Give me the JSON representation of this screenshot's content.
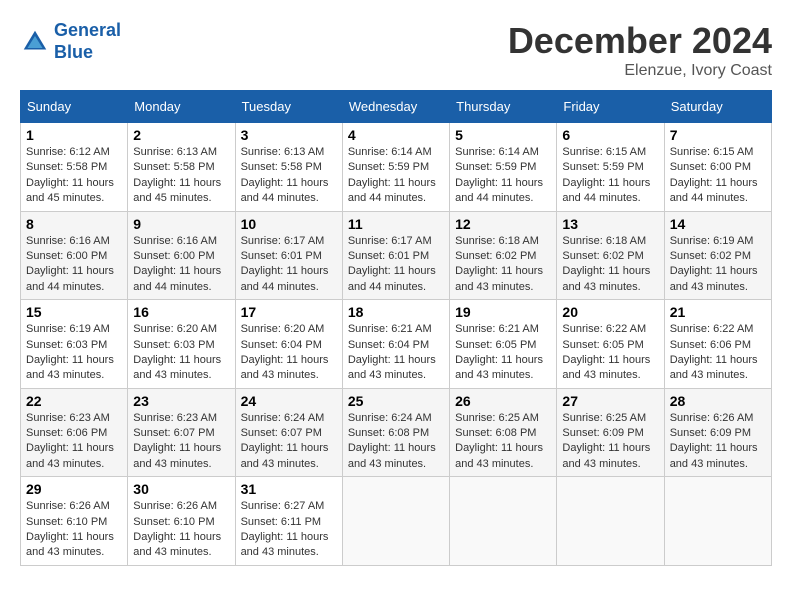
{
  "header": {
    "logo_line1": "General",
    "logo_line2": "Blue",
    "month_title": "December 2024",
    "location": "Elenzue, Ivory Coast"
  },
  "days_of_week": [
    "Sunday",
    "Monday",
    "Tuesday",
    "Wednesday",
    "Thursday",
    "Friday",
    "Saturday"
  ],
  "weeks": [
    [
      {
        "day": "1",
        "sunrise": "6:12 AM",
        "sunset": "5:58 PM",
        "daylight": "11 hours and 45 minutes."
      },
      {
        "day": "2",
        "sunrise": "6:13 AM",
        "sunset": "5:58 PM",
        "daylight": "11 hours and 45 minutes."
      },
      {
        "day": "3",
        "sunrise": "6:13 AM",
        "sunset": "5:58 PM",
        "daylight": "11 hours and 44 minutes."
      },
      {
        "day": "4",
        "sunrise": "6:14 AM",
        "sunset": "5:59 PM",
        "daylight": "11 hours and 44 minutes."
      },
      {
        "day": "5",
        "sunrise": "6:14 AM",
        "sunset": "5:59 PM",
        "daylight": "11 hours and 44 minutes."
      },
      {
        "day": "6",
        "sunrise": "6:15 AM",
        "sunset": "5:59 PM",
        "daylight": "11 hours and 44 minutes."
      },
      {
        "day": "7",
        "sunrise": "6:15 AM",
        "sunset": "6:00 PM",
        "daylight": "11 hours and 44 minutes."
      }
    ],
    [
      {
        "day": "8",
        "sunrise": "6:16 AM",
        "sunset": "6:00 PM",
        "daylight": "11 hours and 44 minutes."
      },
      {
        "day": "9",
        "sunrise": "6:16 AM",
        "sunset": "6:00 PM",
        "daylight": "11 hours and 44 minutes."
      },
      {
        "day": "10",
        "sunrise": "6:17 AM",
        "sunset": "6:01 PM",
        "daylight": "11 hours and 44 minutes."
      },
      {
        "day": "11",
        "sunrise": "6:17 AM",
        "sunset": "6:01 PM",
        "daylight": "11 hours and 44 minutes."
      },
      {
        "day": "12",
        "sunrise": "6:18 AM",
        "sunset": "6:02 PM",
        "daylight": "11 hours and 43 minutes."
      },
      {
        "day": "13",
        "sunrise": "6:18 AM",
        "sunset": "6:02 PM",
        "daylight": "11 hours and 43 minutes."
      },
      {
        "day": "14",
        "sunrise": "6:19 AM",
        "sunset": "6:02 PM",
        "daylight": "11 hours and 43 minutes."
      }
    ],
    [
      {
        "day": "15",
        "sunrise": "6:19 AM",
        "sunset": "6:03 PM",
        "daylight": "11 hours and 43 minutes."
      },
      {
        "day": "16",
        "sunrise": "6:20 AM",
        "sunset": "6:03 PM",
        "daylight": "11 hours and 43 minutes."
      },
      {
        "day": "17",
        "sunrise": "6:20 AM",
        "sunset": "6:04 PM",
        "daylight": "11 hours and 43 minutes."
      },
      {
        "day": "18",
        "sunrise": "6:21 AM",
        "sunset": "6:04 PM",
        "daylight": "11 hours and 43 minutes."
      },
      {
        "day": "19",
        "sunrise": "6:21 AM",
        "sunset": "6:05 PM",
        "daylight": "11 hours and 43 minutes."
      },
      {
        "day": "20",
        "sunrise": "6:22 AM",
        "sunset": "6:05 PM",
        "daylight": "11 hours and 43 minutes."
      },
      {
        "day": "21",
        "sunrise": "6:22 AM",
        "sunset": "6:06 PM",
        "daylight": "11 hours and 43 minutes."
      }
    ],
    [
      {
        "day": "22",
        "sunrise": "6:23 AM",
        "sunset": "6:06 PM",
        "daylight": "11 hours and 43 minutes."
      },
      {
        "day": "23",
        "sunrise": "6:23 AM",
        "sunset": "6:07 PM",
        "daylight": "11 hours and 43 minutes."
      },
      {
        "day": "24",
        "sunrise": "6:24 AM",
        "sunset": "6:07 PM",
        "daylight": "11 hours and 43 minutes."
      },
      {
        "day": "25",
        "sunrise": "6:24 AM",
        "sunset": "6:08 PM",
        "daylight": "11 hours and 43 minutes."
      },
      {
        "day": "26",
        "sunrise": "6:25 AM",
        "sunset": "6:08 PM",
        "daylight": "11 hours and 43 minutes."
      },
      {
        "day": "27",
        "sunrise": "6:25 AM",
        "sunset": "6:09 PM",
        "daylight": "11 hours and 43 minutes."
      },
      {
        "day": "28",
        "sunrise": "6:26 AM",
        "sunset": "6:09 PM",
        "daylight": "11 hours and 43 minutes."
      }
    ],
    [
      {
        "day": "29",
        "sunrise": "6:26 AM",
        "sunset": "6:10 PM",
        "daylight": "11 hours and 43 minutes."
      },
      {
        "day": "30",
        "sunrise": "6:26 AM",
        "sunset": "6:10 PM",
        "daylight": "11 hours and 43 minutes."
      },
      {
        "day": "31",
        "sunrise": "6:27 AM",
        "sunset": "6:11 PM",
        "daylight": "11 hours and 43 minutes."
      },
      null,
      null,
      null,
      null
    ]
  ]
}
